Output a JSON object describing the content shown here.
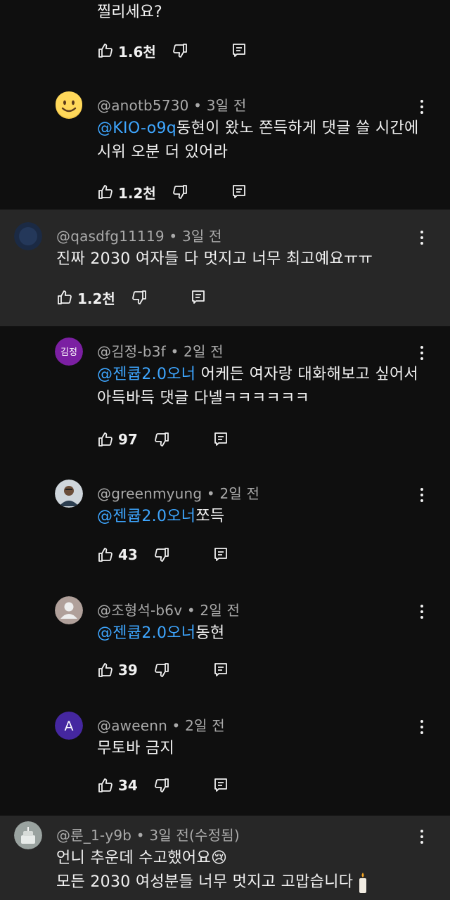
{
  "top": {
    "text_tail": "찔리세요?",
    "likes": "1.6천"
  },
  "comments": [
    {
      "handle": "@anotb5730",
      "time": "3일 전",
      "mention": "@KIO-o9q",
      "text": "동현이 왔노 쫀득하게 댓글 쓸 시간에 시위 오분 더 있어라",
      "likes": "1.2천",
      "avatar": "smiley-emoji"
    },
    {
      "handle": "@qasdfg11119",
      "time": "3일 전",
      "mention": "",
      "text": "진짜 2030 여자들 다 멋지고 너무 최고예요ㅠㅠ",
      "likes": "1.2천",
      "avatar": "dark-blue-photo"
    },
    {
      "handle": "@김정-b3f",
      "time": "2일 전",
      "mention": "@젠큡2.0오너",
      "text": " 어케든 여자랑 대화해보고 싶어서 아득바득 댓글 다넬ㅋㅋㅋㅋㅋㅋ",
      "likes": "97",
      "avatar": "김정",
      "avatar_color": "#7b1fa2"
    },
    {
      "handle": "@greenmyung",
      "time": "2일 전",
      "mention": "@젠큡2.0오너",
      "text": "쪼득",
      "likes": "43",
      "avatar": "person-photo"
    },
    {
      "handle": "@조형석-b6v",
      "time": "2일 전",
      "mention": "@젠큡2.0오너",
      "text": "동현",
      "likes": "39",
      "avatar": "default-person"
    },
    {
      "handle": "@aweenn",
      "time": "2일 전",
      "mention": "",
      "text": "무토바 금지",
      "likes": "34",
      "avatar": "A",
      "avatar_color": "#4527a0"
    },
    {
      "handle": "@룬_1-y9b",
      "time": "3일 전(수정됨)",
      "mention": "",
      "line1": "언니 추운데 수고했어요😢",
      "line2": "모든 2030 여성분들 너무 멋지고 고맙습니다",
      "avatar": "cake-photo"
    }
  ],
  "colors": {
    "background": "#0f0f0f",
    "highlight": "#272727",
    "mention": "#3ea6ff",
    "meta": "#aaaaaa"
  }
}
